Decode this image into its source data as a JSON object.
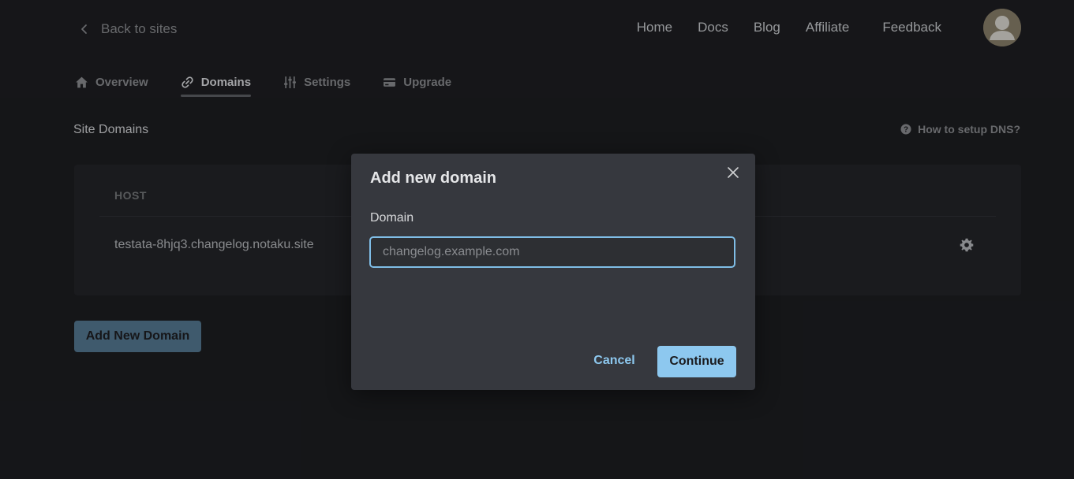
{
  "header": {
    "back_label": "Back to sites",
    "nav": [
      "Home",
      "Docs",
      "Blog",
      "Affiliate",
      "Feedback"
    ],
    "avatar_icon": "user-avatar-icon"
  },
  "tabs": [
    {
      "label": "Overview",
      "icon": "home-icon"
    },
    {
      "label": "Domains",
      "icon": "link-icon",
      "active": true
    },
    {
      "label": "Settings",
      "icon": "sliders-icon"
    },
    {
      "label": "Upgrade",
      "icon": "credit-card-icon"
    }
  ],
  "main": {
    "section_title": "Site Domains",
    "dns_help": "How to setup DNS?",
    "table": {
      "header": "HOST",
      "rows": [
        {
          "host": "testata-8hjq3.changelog.notaku.site"
        }
      ]
    },
    "add_button": "Add New Domain"
  },
  "modal": {
    "title": "Add new domain",
    "field_label": "Domain",
    "field_placeholder": "changelog.example.com",
    "field_value": "",
    "cancel_label": "Cancel",
    "continue_label": "Continue"
  },
  "colors": {
    "accent": "#8dc8ef",
    "background": "#1a1b1e",
    "modal": "#36383e"
  }
}
